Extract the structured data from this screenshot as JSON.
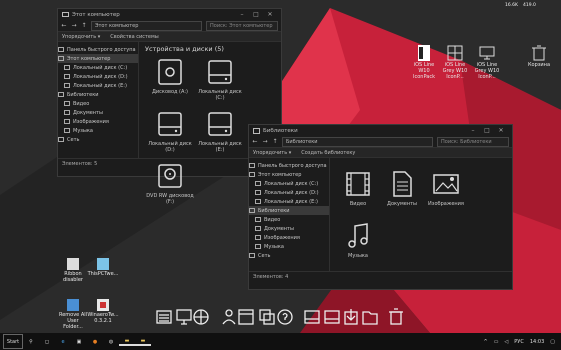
{
  "desktop": {
    "top_right": {
      "cpu": "16.6K",
      "mem": "419.0"
    },
    "icons_right": [
      {
        "label": "iOS Line W10 IconPack"
      },
      {
        "label": "iOS Line Grey W10 IconP..."
      },
      {
        "label": "iOS Line Grey W10 IconP..."
      },
      {
        "label": "Корзина"
      }
    ],
    "icons_left": [
      {
        "label": "Ribbon disabler"
      },
      {
        "label": "ThisPCTwe..."
      },
      {
        "label": "Remove All User Folder..."
      },
      {
        "label": "WinaeroTw... 0.3.2.1"
      }
    ]
  },
  "win1": {
    "title": "Этот компьютер",
    "address": "Этот компьютер",
    "search": "Поиск: Этот компьютер",
    "cmd": [
      "Упорядочить ▾",
      "Свойства системы"
    ],
    "side": [
      "Панель быстрого доступа",
      "Этот компьютер",
      "Локальный диск (C:)",
      "Локальный диск (D:)",
      "Локальный диск (E:)",
      "Библиотеки",
      "Видео",
      "Документы",
      "Изображения",
      "Музыка",
      "Сеть"
    ],
    "section": "Устройства и диски (5)",
    "tiles": [
      {
        "label": "Дисковод (A:)",
        "icon": "floppy-icon"
      },
      {
        "label": "Локальный диск (C:)",
        "icon": "drive-icon"
      },
      {
        "label": "Локальный диск (D:)",
        "icon": "drive-icon"
      },
      {
        "label": "Локальный диск (E:)",
        "icon": "drive-icon"
      },
      {
        "label": "DVD RW дисковод (F:)",
        "icon": "dvd-icon"
      }
    ],
    "status": "Элементов: 5"
  },
  "win2": {
    "title": "Библиотеки",
    "address": "Библиотеки",
    "search": "Поиск: Библиотеки",
    "cmd": [
      "Упорядочить ▾",
      "Создать библиотеку"
    ],
    "side": [
      "Панель быстрого доступа",
      "Этот компьютер",
      "Локальный диск (C:)",
      "Локальный диск (D:)",
      "Локальный диск (E:)",
      "Библиотеки",
      "Видео",
      "Документы",
      "Изображения",
      "Музыка",
      "Сеть"
    ],
    "tiles": [
      {
        "label": "Видео",
        "icon": "video-icon"
      },
      {
        "label": "Документы",
        "icon": "document-icon"
      },
      {
        "label": "Изображения",
        "icon": "image-icon"
      },
      {
        "label": "Музыка",
        "icon": "music-icon"
      }
    ],
    "status": "Элементов: 4"
  },
  "taskbar": {
    "start": "Start",
    "lang": "РУС",
    "time": "14:03"
  },
  "colors": {
    "accent": "#d1263c",
    "window": "#1c1c1c",
    "taskbar": "#101010"
  }
}
